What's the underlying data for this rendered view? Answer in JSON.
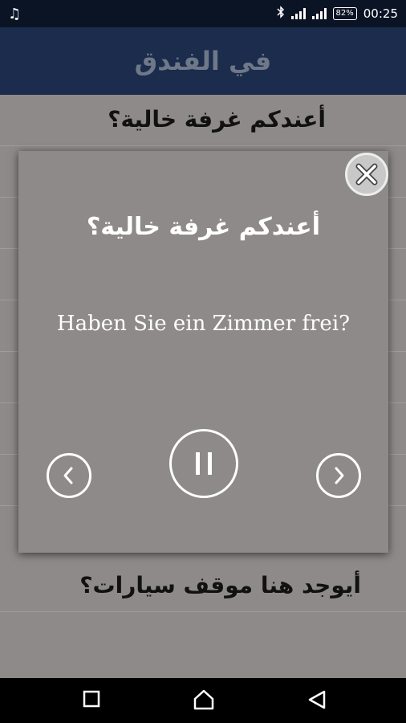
{
  "status": {
    "time": "00:25",
    "battery": "82%",
    "left_icon": "music-note-icon",
    "right_icons": [
      "bluetooth-icon",
      "signal-icon",
      "battery-icon"
    ]
  },
  "appbar": {
    "title": "في الفندق"
  },
  "list": {
    "items": [
      {
        "label": "أعندكم غرفة خالية؟"
      },
      {
        "label": ""
      },
      {
        "label": ""
      },
      {
        "label": ""
      },
      {
        "label": ""
      },
      {
        "label": ""
      },
      {
        "label": ""
      },
      {
        "label": ""
      },
      {
        "label": "أيوجد هنا موقف سيارات؟"
      }
    ]
  },
  "dialog": {
    "arabic": "أعندكم غرفة خالية؟",
    "german": "Haben Sie ein Zimmer frei?",
    "buttons": [
      "close-icon",
      "previous-icon",
      "pause-icon",
      "next-icon"
    ]
  },
  "navbar": {
    "buttons": [
      "back-icon",
      "home-icon",
      "recents-icon"
    ]
  }
}
